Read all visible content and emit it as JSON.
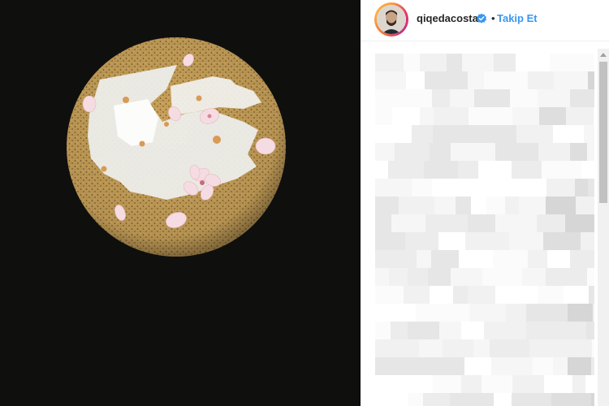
{
  "post": {
    "username": "qiqedacosta",
    "separator": "•",
    "follow_label": "Takip Et",
    "verified": true
  },
  "photo": {
    "subject": "dessert-plate",
    "background_color": "#0f0f0e"
  },
  "comments": {
    "state": "pixelated"
  },
  "colors": {
    "accent": "#3897f0",
    "text": "#262626",
    "verified_badge": "#3897f0"
  }
}
